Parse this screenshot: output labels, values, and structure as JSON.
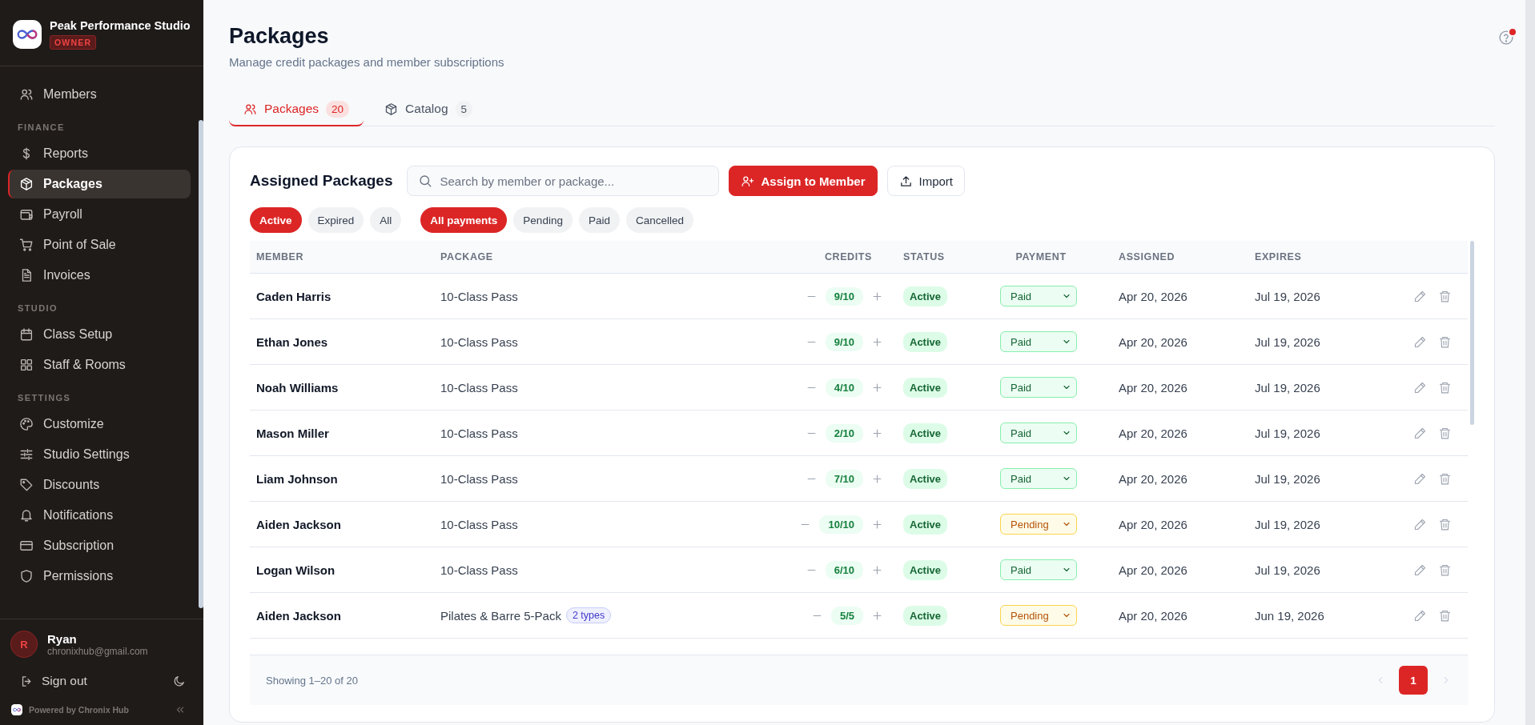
{
  "sidebar": {
    "studio_name": "Peak Performance Studio",
    "role": "OWNER",
    "nav": [
      {
        "kind": "link",
        "label": "Members",
        "selected": false
      },
      {
        "kind": "heading",
        "label": "FINANCE"
      },
      {
        "kind": "link",
        "label": "Reports",
        "selected": false
      },
      {
        "kind": "link",
        "label": "Packages",
        "selected": true
      },
      {
        "kind": "link",
        "label": "Payroll",
        "selected": false
      },
      {
        "kind": "link",
        "label": "Point of Sale",
        "selected": false
      },
      {
        "kind": "link",
        "label": "Invoices",
        "selected": false
      },
      {
        "kind": "heading",
        "label": "STUDIO"
      },
      {
        "kind": "link",
        "label": "Class Setup",
        "selected": false
      },
      {
        "kind": "link",
        "label": "Staff & Rooms",
        "selected": false
      },
      {
        "kind": "heading",
        "label": "SETTINGS"
      },
      {
        "kind": "link",
        "label": "Customize",
        "selected": false
      },
      {
        "kind": "link",
        "label": "Studio Settings",
        "selected": false
      },
      {
        "kind": "link",
        "label": "Discounts",
        "selected": false
      },
      {
        "kind": "link",
        "label": "Notifications",
        "selected": false
      },
      {
        "kind": "link",
        "label": "Subscription",
        "selected": false
      },
      {
        "kind": "link",
        "label": "Permissions",
        "selected": false
      }
    ],
    "user": {
      "initial": "R",
      "name": "Ryan",
      "email": "chronixhub@gmail.com"
    },
    "sign_out": "Sign out",
    "powered_by": "Powered by Chronix Hub"
  },
  "header": {
    "title": "Packages",
    "subtitle": "Manage credit packages and member subscriptions",
    "help_notification": true
  },
  "tabs": [
    {
      "label": "Packages",
      "count": "20",
      "selected": true
    },
    {
      "label": "Catalog",
      "count": "5",
      "selected": false
    }
  ],
  "card": {
    "title": "Assigned Packages",
    "search": {
      "placeholder": "Search by member or package..."
    },
    "buttons": [
      {
        "kind": "primary",
        "label": "Assign to Member"
      },
      {
        "kind": "secondary",
        "label": "Import"
      }
    ],
    "status_filters": [
      {
        "label": "Active",
        "selected": true
      },
      {
        "label": "Expired",
        "selected": false
      },
      {
        "label": "All",
        "selected": false
      }
    ],
    "payment_filters": [
      {
        "label": "All payments",
        "selected": true
      },
      {
        "label": "Pending",
        "selected": false
      },
      {
        "label": "Paid",
        "selected": false
      },
      {
        "label": "Cancelled",
        "selected": false
      }
    ]
  },
  "table": {
    "columns": [
      "MEMBER",
      "PACKAGE",
      "CREDITS",
      "STATUS",
      "PAYMENT",
      "ASSIGNED",
      "EXPIRES"
    ],
    "rows": [
      {
        "member": "Caden Harris",
        "package": "10-Class Pass",
        "credits": "9/10",
        "status": "Active",
        "payment": {
          "kind": "paid",
          "label": "Paid"
        },
        "assigned": "Apr 20, 2026",
        "expires": "Jul 19, 2026"
      },
      {
        "member": "Ethan Jones",
        "package": "10-Class Pass",
        "credits": "9/10",
        "status": "Active",
        "payment": {
          "kind": "paid",
          "label": "Paid"
        },
        "assigned": "Apr 20, 2026",
        "expires": "Jul 19, 2026"
      },
      {
        "member": "Noah Williams",
        "package": "10-Class Pass",
        "credits": "4/10",
        "status": "Active",
        "payment": {
          "kind": "paid",
          "label": "Paid"
        },
        "assigned": "Apr 20, 2026",
        "expires": "Jul 19, 2026"
      },
      {
        "member": "Mason Miller",
        "package": "10-Class Pass",
        "credits": "2/10",
        "status": "Active",
        "payment": {
          "kind": "paid",
          "label": "Paid"
        },
        "assigned": "Apr 20, 2026",
        "expires": "Jul 19, 2026"
      },
      {
        "member": "Liam Johnson",
        "package": "10-Class Pass",
        "credits": "7/10",
        "status": "Active",
        "payment": {
          "kind": "paid",
          "label": "Paid"
        },
        "assigned": "Apr 20, 2026",
        "expires": "Jul 19, 2026"
      },
      {
        "member": "Aiden Jackson",
        "package": "10-Class Pass",
        "credits": "10/10",
        "status": "Active",
        "payment": {
          "kind": "pending",
          "label": "Pending"
        },
        "assigned": "Apr 20, 2026",
        "expires": "Jul 19, 2026"
      },
      {
        "member": "Logan Wilson",
        "package": "10-Class Pass",
        "credits": "6/10",
        "status": "Active",
        "payment": {
          "kind": "paid",
          "label": "Paid"
        },
        "assigned": "Apr 20, 2026",
        "expires": "Jul 19, 2026"
      },
      {
        "member": "Aiden Jackson",
        "package": "Pilates & Barre 5-Pack",
        "tag": "2 types",
        "credits": "5/5",
        "status": "Active",
        "payment": {
          "kind": "pending",
          "label": "Pending"
        },
        "assigned": "Apr 20, 2026",
        "expires": "Jun 19, 2026"
      }
    ],
    "footer": {
      "showing": "Showing 1–20 of 20",
      "pages": [
        {
          "label": "1",
          "selected": true
        }
      ]
    }
  }
}
